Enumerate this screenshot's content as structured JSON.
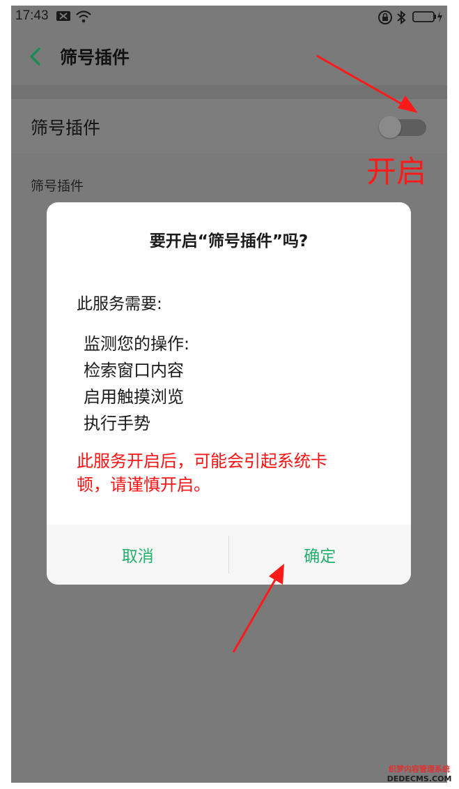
{
  "status_bar": {
    "time": "17:43"
  },
  "app_bar": {
    "title": "筛号插件"
  },
  "setting_row": {
    "label": "筛号插件",
    "toggle_state": "off"
  },
  "section": {
    "label": "筛号插件"
  },
  "annotation": {
    "text": "开启",
    "color": "#ff1a1a"
  },
  "dialog": {
    "title": "要开启“筛号插件”吗?",
    "intro": "此服务需要:",
    "permissions": [
      "监测您的操作:",
      "检索窗口内容",
      "启用触摸浏览",
      "执行手势"
    ],
    "warning_line1": "此服务开启后，可能会引起系统卡",
    "warning_line2": "顿，请谨慎开启。",
    "cancel_label": "取消",
    "confirm_label": "确定",
    "button_color": "#23b06c"
  },
  "watermark": {
    "line1": "织梦内容管理系统",
    "line2": "DEDECMS.COM"
  }
}
